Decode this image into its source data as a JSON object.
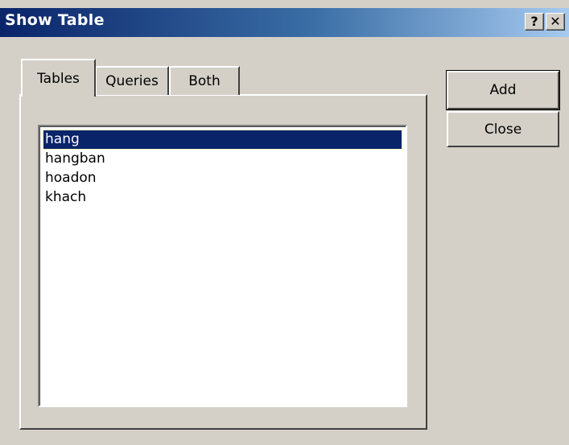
{
  "window": {
    "title": "Show Table",
    "help_label": "?",
    "close_label": "✕"
  },
  "tabs": [
    {
      "label": "Tables",
      "selected": true
    },
    {
      "label": "Queries",
      "selected": false
    },
    {
      "label": "Both",
      "selected": false
    }
  ],
  "list": {
    "items": [
      "hang",
      "hangban",
      "hoadon",
      "khach"
    ],
    "selected_index": 0
  },
  "buttons": {
    "add_label": "Add",
    "close_label": "Close"
  },
  "colors": {
    "title_gradient_start": "#0a246a",
    "title_gradient_end": "#a6caf0",
    "selection_background": "#0a246a",
    "dialog_face": "#d4d0c8"
  }
}
